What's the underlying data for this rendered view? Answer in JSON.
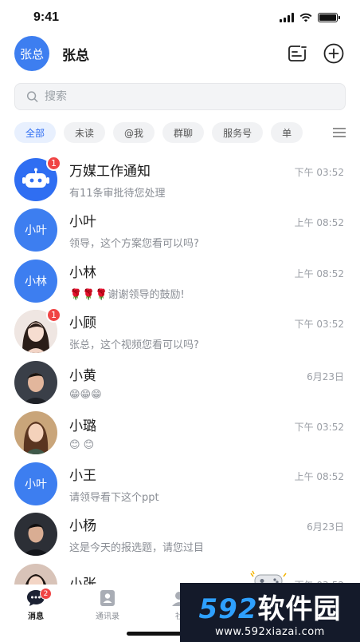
{
  "status_bar": {
    "time": "9:41"
  },
  "header": {
    "avatar_text": "张总",
    "user_name": "张总"
  },
  "search": {
    "placeholder": "搜索"
  },
  "filters": [
    "全部",
    "未读",
    "@我",
    "群聊",
    "服务号",
    "单"
  ],
  "conversations": [
    {
      "name": "万媒工作通知",
      "time": "下午 03:52",
      "message": "有11条审批待您处理",
      "avatar": "robot-icon",
      "badge": "1"
    },
    {
      "name": "小叶",
      "time": "上午 08:52",
      "message": "领导，这个方案您看可以吗?",
      "avatar_text": "小叶"
    },
    {
      "name": "小林",
      "time": "上午 08:52",
      "message": "🌹🌹🌹谢谢领导的鼓励!",
      "avatar_text": "小林"
    },
    {
      "name": "小顾",
      "time": "下午 03:52",
      "message": "张总，这个视频您看可以吗?",
      "avatar": "woman-photo",
      "badge": "1"
    },
    {
      "name": "小黄",
      "time": "6月23日",
      "message": "😁😁😁",
      "avatar": "man-photo"
    },
    {
      "name": "小璐",
      "time": "下午 03:52",
      "message": "😊 😊",
      "avatar": "woman-photo-2"
    },
    {
      "name": "小王",
      "time": "上午 08:52",
      "message": "请领导看下这个ppt",
      "avatar_text": "小叶"
    },
    {
      "name": "小杨",
      "time": "6月23日",
      "message": "这是今天的报选题，请您过目",
      "avatar": "man-photo-2"
    },
    {
      "name": "小张",
      "time": "下午 03:52",
      "message": "",
      "avatar": "woman-photo-3"
    }
  ],
  "tabbar": {
    "tabs": [
      {
        "label": "消息",
        "badge": "2"
      },
      {
        "label": "通讯录"
      },
      {
        "label": "社"
      }
    ]
  },
  "watermark": {
    "brand_num": "592",
    "brand_text": "软件园",
    "url": "www.592xiazai.com"
  },
  "colors": {
    "accent": "#3d7ef0",
    "badge": "#f04444",
    "chip_active": "#2f6ef2"
  }
}
